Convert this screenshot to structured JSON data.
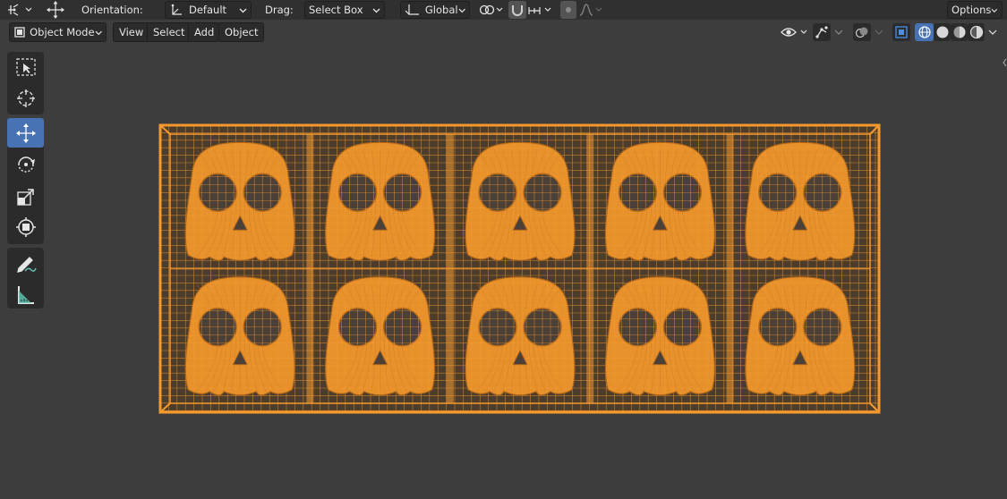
{
  "topbar": {
    "orientation_label": "Orientation:",
    "orientation_value": "Default",
    "drag_label": "Drag:",
    "drag_value": "Select Box",
    "transform_space_value": "Global",
    "options_label": "Options"
  },
  "header": {
    "mode_value": "Object Mode",
    "menus": [
      "View",
      "Select",
      "Add",
      "Object"
    ]
  },
  "toolbar": {
    "tools": [
      {
        "name": "select-box-tool",
        "icon": "select-box-icon",
        "active": false
      },
      {
        "name": "cursor-tool",
        "icon": "cursor-icon",
        "active": false
      },
      {
        "name": "move-tool",
        "icon": "move-icon",
        "active": true
      },
      {
        "name": "rotate-tool",
        "icon": "rotate-icon",
        "active": false
      },
      {
        "name": "scale-tool",
        "icon": "scale-icon",
        "active": false
      },
      {
        "name": "transform-tool",
        "icon": "transform-icon",
        "active": false
      },
      {
        "name": "annotate-tool",
        "icon": "annotate-icon",
        "active": false
      },
      {
        "name": "measure-tool",
        "icon": "measure-icon",
        "active": false
      }
    ]
  },
  "viewport": {
    "wire_color": "#f5992d",
    "background_color": "#3d3d3d",
    "skull_rows": 2,
    "skull_columns": 5
  },
  "colors": {
    "accent": "#4772b3",
    "header_bg": "#303030",
    "button_bg": "#2b2b2b"
  }
}
